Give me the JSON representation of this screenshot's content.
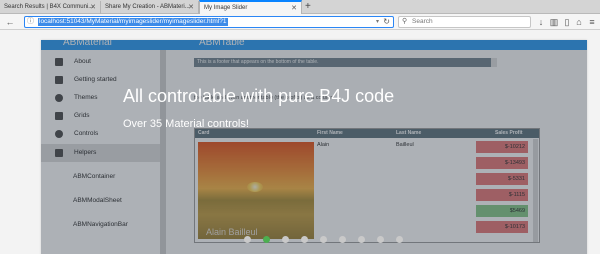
{
  "browser": {
    "tabs": [
      {
        "label": "Search Results | B4X Communi..."
      },
      {
        "label": "Share My Creation - ABMateri..."
      },
      {
        "label": "My Image Slider",
        "active": true
      }
    ],
    "url": "localhost:51043/MyMaterial/myimageslider/myimageslider.html?1",
    "search_placeholder": "Search",
    "accent_color": "#0a84ff"
  },
  "slide": {
    "header_left": "ABMaterial",
    "header_right": "ABMTable",
    "sidebar_items": [
      {
        "label": "About",
        "icon": "info-icon"
      },
      {
        "label": "Getting started",
        "icon": "chat-icon"
      },
      {
        "label": "Themes",
        "icon": "contrast-icon"
      },
      {
        "label": "Grids",
        "icon": "grid-icon"
      },
      {
        "label": "Controls",
        "icon": "palette-icon"
      },
      {
        "label": "Helpers",
        "icon": "widgets-icon",
        "selected": true
      },
      {
        "label": "ABMContainer"
      },
      {
        "label": "ABMModalSheet"
      },
      {
        "label": "ABMNavigationBar"
      }
    ],
    "footer_strip": "This is a footer that appears on the bottom of the table.",
    "content_text": "the table and even another table (the profits) as a column",
    "table": {
      "headers": [
        "Card",
        "First Name",
        "Last Name",
        "Sales Profit"
      ],
      "first_name": "Alain",
      "last_name": "Bailleul",
      "card_name": "Alain Bailleul",
      "profits": [
        {
          "value": "$-10212",
          "color": "#e57373"
        },
        {
          "value": "$-13493",
          "color": "#e57373"
        },
        {
          "value": "$-5331",
          "color": "#e57373"
        },
        {
          "value": "$-1115",
          "color": "#e57373"
        },
        {
          "value": "$5469",
          "color": "#81c784"
        },
        {
          "value": "$-10173",
          "color": "#e57373"
        }
      ]
    },
    "caption_title": "All controlable with pure B4J code",
    "caption_subtitle": "Over 35 Material controls!"
  },
  "pager": {
    "count": 9,
    "active_index": 1,
    "active_color": "#4caf50"
  }
}
